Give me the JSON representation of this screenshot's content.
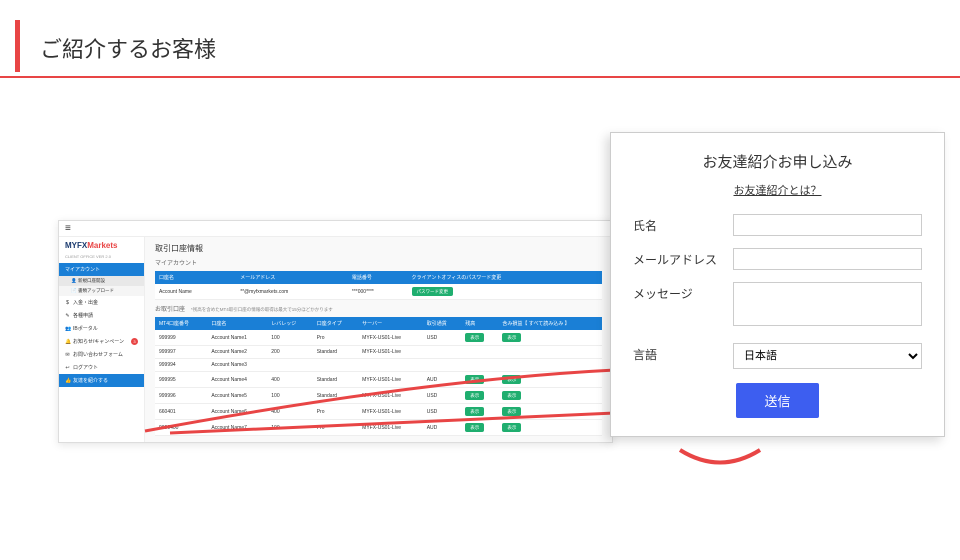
{
  "page_title": "ご紹介するお客様",
  "app": {
    "logo": "MYFX",
    "logo2": "Markets",
    "logo_sub": "CLIENT OFFICE VER 2.0",
    "sidebar": [
      {
        "label": "マイアカウント",
        "style": "blue"
      },
      {
        "label": "新規口座開設",
        "style": "sub-sel",
        "icon": "👤"
      },
      {
        "label": "書類アップロード",
        "style": "sub",
        "icon": "📄"
      },
      {
        "label": "入金・出金",
        "icon": "$"
      },
      {
        "label": "各種申請",
        "icon": "✎"
      },
      {
        "label": "IBポータル",
        "icon": "👥"
      },
      {
        "label": "お知らせ/キャンペーン",
        "icon": "🔔",
        "badge": "3"
      },
      {
        "label": "お問い合わせフォーム",
        "icon": "✉"
      },
      {
        "label": "ログアウト",
        "icon": "↩"
      },
      {
        "label": "友達を紹介する",
        "style": "active-blue",
        "icon": "👍"
      }
    ],
    "section1_title": "取引口座情報",
    "section1_sub": "マイアカウント",
    "t1_headers": [
      "口座名",
      "メールアドレス",
      "電話番号",
      "クライアントオフィスのパスワード変更"
    ],
    "t1_row": [
      "Account Name",
      "**@myfxmarkets.com",
      "***000****"
    ],
    "t1_btn": "パスワード変更",
    "section2_title": "お取引口座",
    "section2_note": "*残高を含めたMT4取引口座の情報の取得は最大で15分ほどかかります",
    "t2_headers": [
      "MT4口座番号",
      "口座名",
      "レバレッジ",
      "口座タイプ",
      "サーバー",
      "取引通貨",
      "残高",
      "含み損益【 すべて読み込み 】"
    ],
    "t2_rows": [
      [
        "999999",
        "Account Name1",
        "100",
        "Pro",
        "MYFX-US01-Live",
        "USD"
      ],
      [
        "999997",
        "Account Name2",
        "200",
        "Standard",
        "MYFX-US01-Live",
        "",
        ""
      ],
      [
        "999994",
        "Account Name3",
        "",
        "",
        "",
        "",
        ""
      ],
      [
        "999995",
        "Account Name4",
        "400",
        "Standard",
        "MYFX-US01-Live",
        "AUD"
      ],
      [
        "999996",
        "Account Name5",
        "100",
        "Standard",
        "MYFX-US01-Live",
        "USD"
      ],
      [
        "660401",
        "Account Name6",
        "400",
        "Pro",
        "MYFX-US01-Live",
        "USD"
      ],
      [
        "9000400",
        "Account Name7",
        "100",
        "Pro",
        "MYFX-US01-Live",
        "AUD"
      ]
    ],
    "t2_btn": "表示"
  },
  "form": {
    "title": "お友達紹介お申し込み",
    "link": "お友達紹介とは？",
    "fields": {
      "name": "氏名",
      "email": "メールアドレス",
      "message": "メッセージ",
      "lang": "言語"
    },
    "lang_value": "日本語",
    "submit": "送信"
  }
}
